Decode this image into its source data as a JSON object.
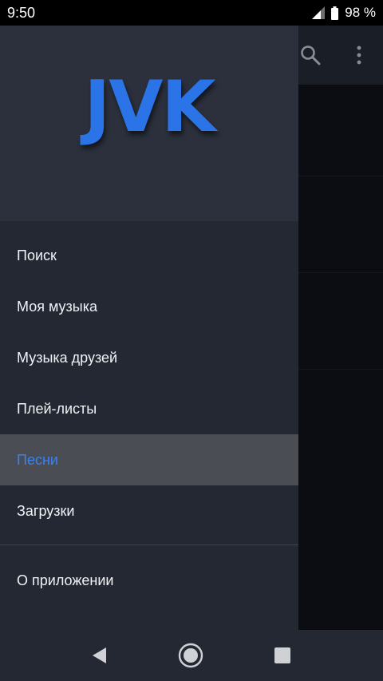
{
  "status_bar": {
    "time": "9:50",
    "battery_percent": "98 %",
    "battery_level": 0.98,
    "icons": [
      "signal-icon",
      "battery-icon"
    ]
  },
  "toolbar": {
    "icons": [
      "search-icon",
      "more-vert-icon"
    ]
  },
  "drawer": {
    "logo": "JVK",
    "items": [
      {
        "label": "Поиск"
      },
      {
        "label": "Моя музыка"
      },
      {
        "label": "Музыка друзей"
      },
      {
        "label": "Плей-листы"
      },
      {
        "label": "Песни",
        "selected": true
      },
      {
        "label": "Загрузки"
      }
    ],
    "footer_item": {
      "label": "О приложении"
    }
  },
  "nav_bar": {
    "icons": [
      "back-icon",
      "home-icon",
      "recents-icon"
    ]
  },
  "colors": {
    "accent": "#2b74e8",
    "selected_text": "#3a82f2",
    "drawer_bg": "#242833",
    "header_bg": "#2b303c",
    "selected_bg": "#4a4d54"
  }
}
